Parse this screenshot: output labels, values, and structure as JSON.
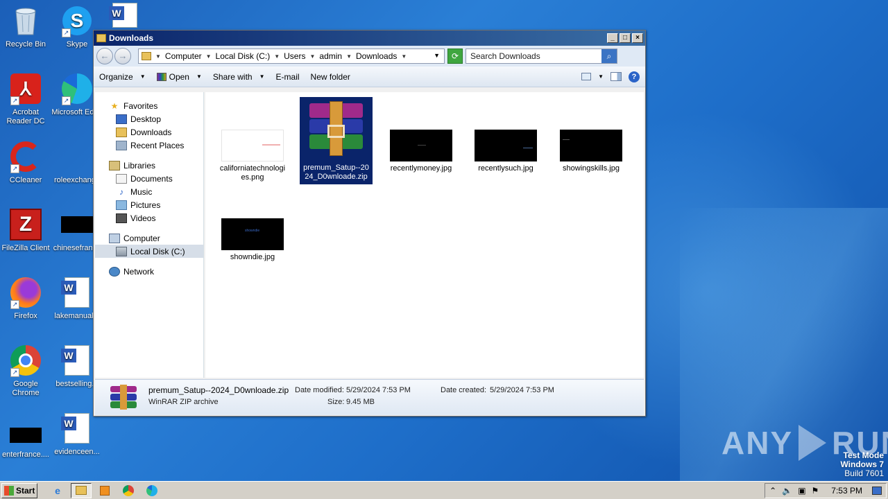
{
  "desktop": {
    "icons": [
      {
        "label": "Recycle Bin"
      },
      {
        "label": "Skype"
      },
      {
        "label": "Acrobat Reader DC"
      },
      {
        "label": "Microsoft Edge"
      },
      {
        "label": "CCleaner"
      },
      {
        "label": "roleexchange"
      },
      {
        "label": "FileZilla Client"
      },
      {
        "label": "chinesefrance"
      },
      {
        "label": "Firefox"
      },
      {
        "label": "lakemanual..."
      },
      {
        "label": "Google Chrome"
      },
      {
        "label": "bestselling..."
      },
      {
        "label": "enterfrance...."
      },
      {
        "label": "evidenceen..."
      }
    ],
    "word_icon_text": "W"
  },
  "window": {
    "title": "Downloads",
    "controls": {
      "minimize": "_",
      "maximize": "□",
      "close": "×"
    },
    "nav": {
      "back": "←",
      "forward": "→"
    },
    "breadcrumb": [
      "Computer",
      "Local Disk (C:)",
      "Users",
      "admin",
      "Downloads"
    ],
    "search_placeholder": "Search Downloads",
    "toolbar": {
      "organize": "Organize",
      "open": "Open",
      "share_with": "Share with",
      "email": "E-mail",
      "new_folder": "New folder"
    },
    "navpane": {
      "favorites": "Favorites",
      "desktop": "Desktop",
      "downloads": "Downloads",
      "recent_places": "Recent Places",
      "libraries": "Libraries",
      "documents": "Documents",
      "music": "Music",
      "pictures": "Pictures",
      "videos": "Videos",
      "computer": "Computer",
      "local_disk": "Local Disk (C:)",
      "network": "Network"
    },
    "files": [
      {
        "name": "californiatechnologies.png",
        "line1": "californiatechnologi",
        "line2": "es.png"
      },
      {
        "name": "premum_Satup--2024_D0wnloade.zip",
        "line1": "premum_Satup--20",
        "line2": "24_D0wnloade.zip"
      },
      {
        "name": "recentlymoney.jpg"
      },
      {
        "name": "recentlysuch.jpg"
      },
      {
        "name": "showingskills.jpg"
      },
      {
        "name": "showndie.jpg",
        "thumb_text": "showndie"
      }
    ],
    "details": {
      "name": "premum_Satup--2024_D0wnloade.zip",
      "type": "WinRAR ZIP archive",
      "date_modified_label": "Date modified:",
      "date_modified": "5/29/2024 7:53 PM",
      "date_created_label": "Date created:",
      "date_created": "5/29/2024 7:53 PM",
      "size_label": "Size:",
      "size": "9.45 MB"
    }
  },
  "taskbar": {
    "start": "Start",
    "clock": "7:53 PM"
  },
  "watermark": {
    "line1": "Test Mode",
    "line2": "Windows 7",
    "line3": "Build 7601",
    "brand": "ANY RUN",
    "brand_left": "ANY",
    "brand_right": "RUN"
  }
}
